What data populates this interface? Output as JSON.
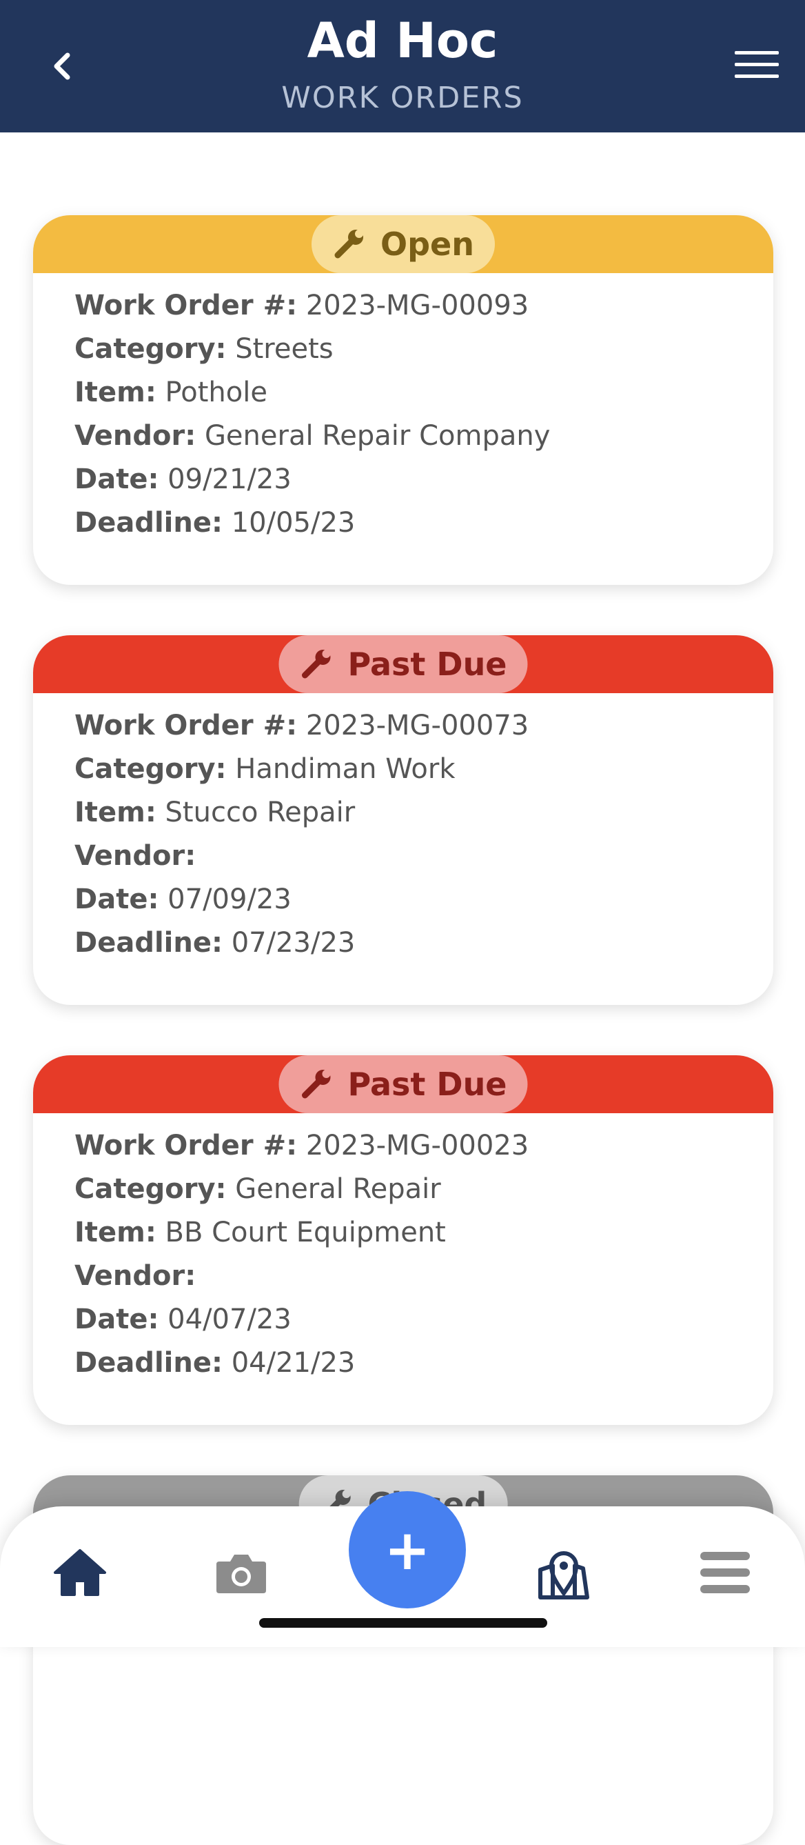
{
  "header": {
    "title": "Ad Hoc",
    "subtitle": "WORK ORDERS"
  },
  "colors": {
    "header_bg": "#22365c",
    "open_band": "#f3bb41",
    "open_pill": "#f8de99",
    "open_text": "#7a5e16",
    "pastdue_band": "#e63b28",
    "pastdue_pill": "#f09e9a",
    "pastdue_text": "#8a1f1a",
    "closed_band": "#9a9a9a",
    "closed_pill": "#d6d6d6",
    "fab": "#4780f0",
    "nav_active": "#22365c",
    "nav_inactive": "#8c8c8c"
  },
  "labels": {
    "work_order": "Work Order #:",
    "category": "Category:",
    "item": "Item:",
    "vendor": "Vendor:",
    "date": "Date:",
    "deadline": "Deadline:"
  },
  "work_orders": [
    {
      "status": "Open",
      "number": "2023-MG-00093",
      "category": "Streets",
      "item": "Pothole",
      "vendor": "General Repair Company",
      "date": "09/21/23",
      "deadline": "10/05/23"
    },
    {
      "status": "Past Due",
      "number": "2023-MG-00073",
      "category": "Handiman Work",
      "item": "Stucco Repair",
      "vendor": "",
      "date": "07/09/23",
      "deadline": "07/23/23"
    },
    {
      "status": "Past Due",
      "number": "2023-MG-00023",
      "category": "General Repair",
      "item": "BB Court Equipment",
      "vendor": "",
      "date": "04/07/23",
      "deadline": "04/21/23"
    },
    {
      "status": "Closed"
    }
  ],
  "nav": {
    "items": [
      "home-icon",
      "camera-icon",
      "add-button",
      "map-icon",
      "menu-icon"
    ],
    "fab_label": "+"
  }
}
